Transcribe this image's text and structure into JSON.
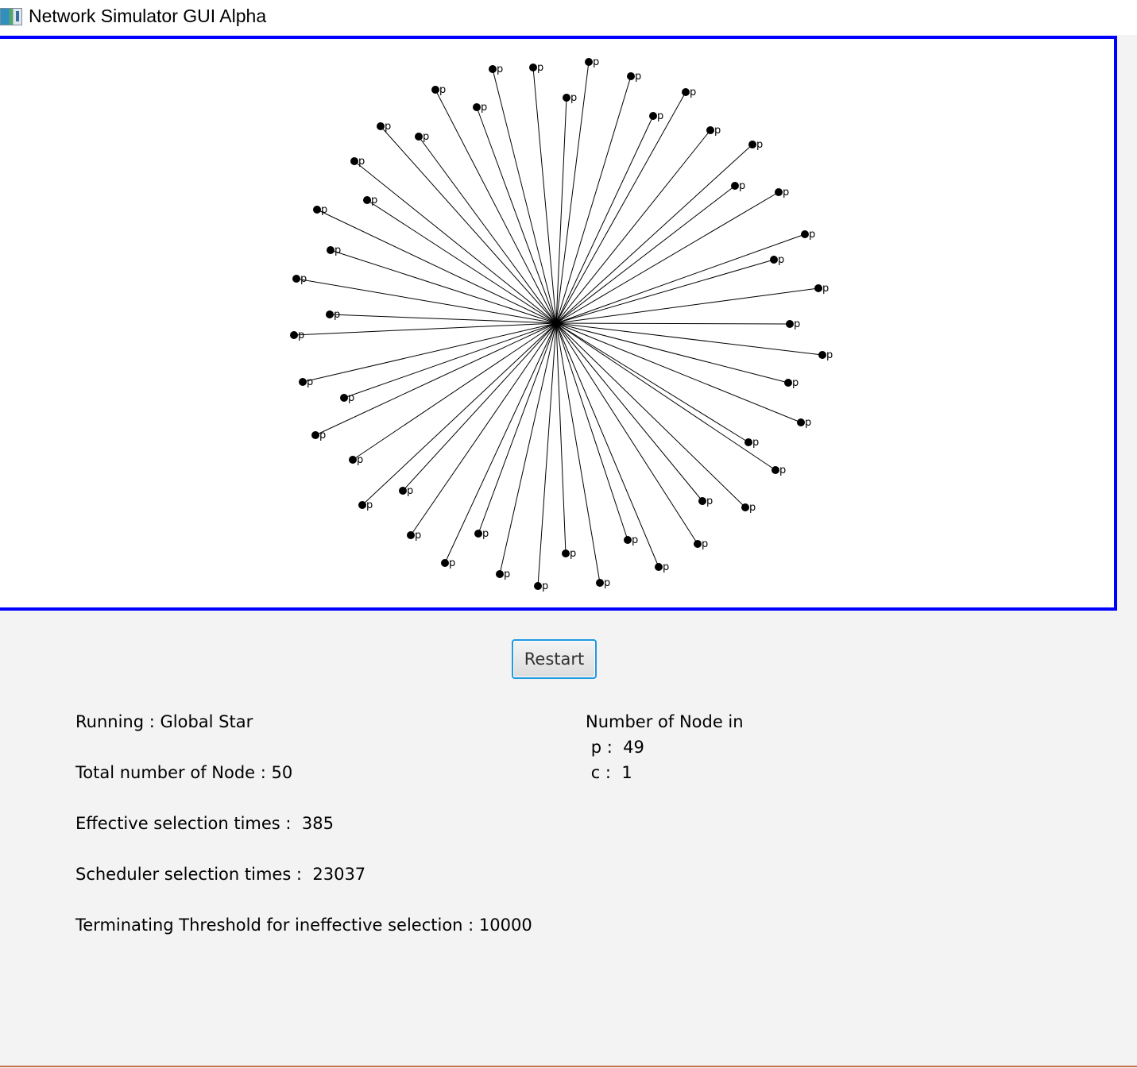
{
  "window": {
    "title": "Network Simulator GUI Alpha",
    "icon": "app-window-icon"
  },
  "graph": {
    "topology": "star",
    "colors": {
      "frame": "#0000ff",
      "edge": "#000000",
      "node": "#000000"
    },
    "center_node": {
      "state": "c"
    },
    "node_label": "p",
    "leaf_count": 49
  },
  "controls": {
    "restart_label": "Restart"
  },
  "stats": {
    "running_label": "Running : ",
    "running_value": "Global Star",
    "total_label": "Total number of Node : ",
    "total_value": "50",
    "effective_label": "Effective selection times :  ",
    "effective_value": "385",
    "scheduler_label": "Scheduler selection times :  ",
    "scheduler_value": "23037",
    "threshold_label": "Terminating Threshold for ineffective selection : ",
    "threshold_value": "10000"
  },
  "node_counts": {
    "heading": "Number of Node in",
    "rows": [
      {
        "state": "p",
        "sep": " :  ",
        "count": "49"
      },
      {
        "state": "c",
        "sep": " :  ",
        "count": "1"
      }
    ]
  }
}
